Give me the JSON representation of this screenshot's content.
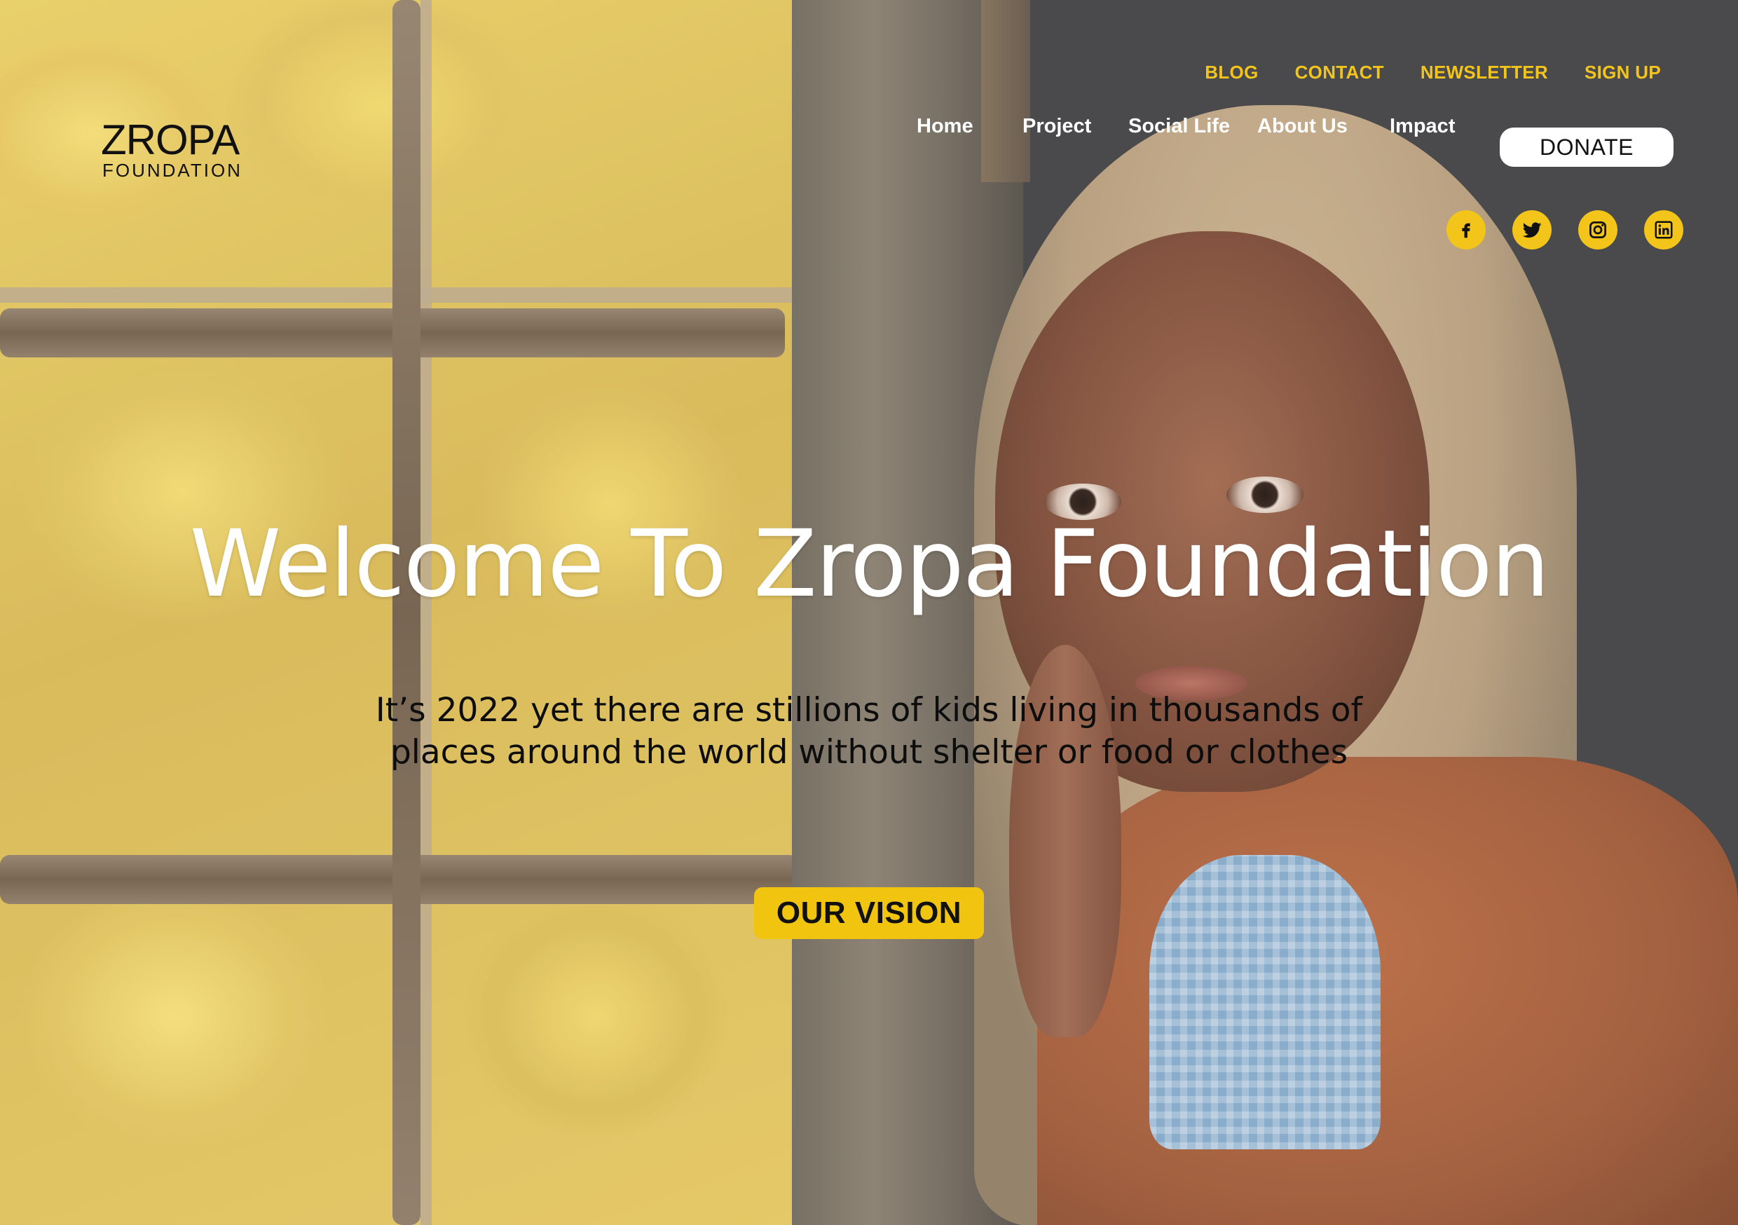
{
  "utility_nav": {
    "items": [
      {
        "label": "BLOG"
      },
      {
        "label": "CONTACT"
      },
      {
        "label": "NEWSLETTER"
      },
      {
        "label": "SIGN UP"
      }
    ]
  },
  "logo": {
    "main": "ZROPA",
    "sub": "FOUNDATION"
  },
  "main_nav": {
    "items": [
      {
        "label": "Home"
      },
      {
        "label": "Project"
      },
      {
        "label": "Social Life"
      },
      {
        "label": "About Us"
      },
      {
        "label": "Impact"
      }
    ],
    "donate_label": "DONATE"
  },
  "social": {
    "items": [
      {
        "icon": "facebook-icon"
      },
      {
        "icon": "twitter-icon"
      },
      {
        "icon": "instagram-icon"
      },
      {
        "icon": "linkedin-icon"
      }
    ]
  },
  "hero": {
    "title": "Welcome To Zropa Foundation",
    "subtitle_line1": "It’s 2022 yet there are stillions of kids living in thousands of",
    "subtitle_line2": "places around the world without shelter or food or clothes",
    "cta_label": "OUR VISION"
  },
  "colors": {
    "accent": "#f3c51b",
    "nav_text": "#ffffff",
    "dark_background": "#3b3b3d"
  }
}
